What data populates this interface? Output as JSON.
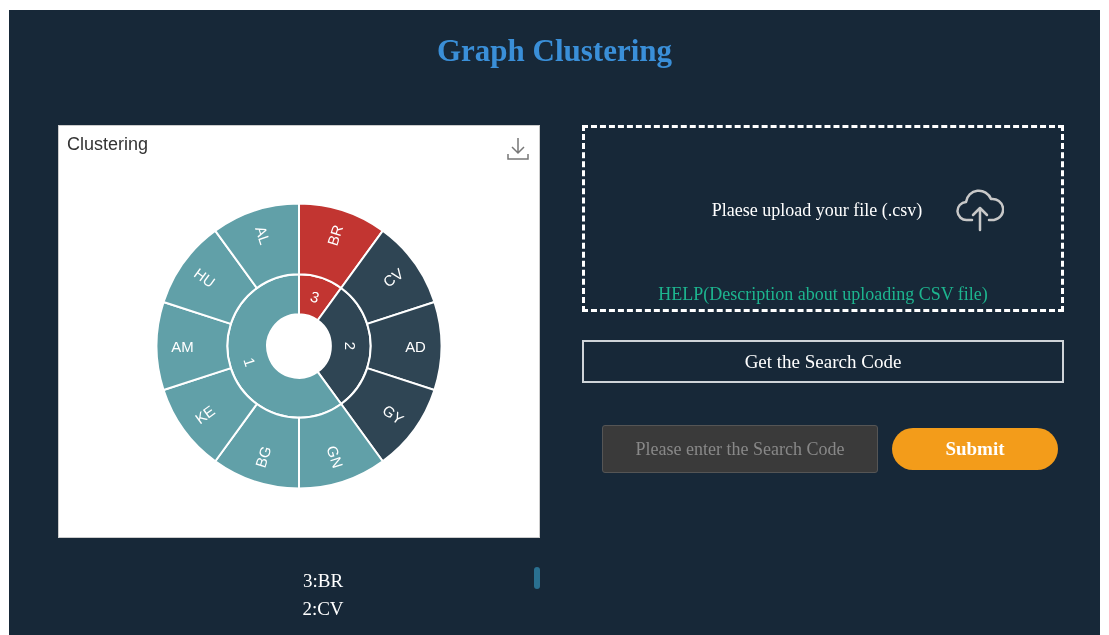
{
  "title": "Graph Clustering",
  "clustering_panel": {
    "title": "Clustering",
    "sunburst": {
      "clusters": [
        {
          "label": "3",
          "color": "#c23531",
          "children": [
            {
              "label": "BR"
            }
          ]
        },
        {
          "label": "2",
          "color": "#2f4554",
          "children": [
            {
              "label": "CV"
            },
            {
              "label": "AD"
            },
            {
              "label": "GY"
            }
          ]
        },
        {
          "label": "1",
          "color": "#61a0a8",
          "children": [
            {
              "label": "GN"
            },
            {
              "label": "BG"
            },
            {
              "label": "KE"
            },
            {
              "label": "AM"
            },
            {
              "label": "HU"
            },
            {
              "label": "AL"
            }
          ]
        }
      ]
    }
  },
  "results": [
    "3:BR",
    "2:CV"
  ],
  "upload": {
    "prompt": "Plaese upload your file (.csv)",
    "help_link": "HELP(Description about uploading CSV file)"
  },
  "get_code_button": "Get the Search Code",
  "search_code": {
    "placeholder": "Please enter the Search Code"
  },
  "submit_button": "Submit"
}
